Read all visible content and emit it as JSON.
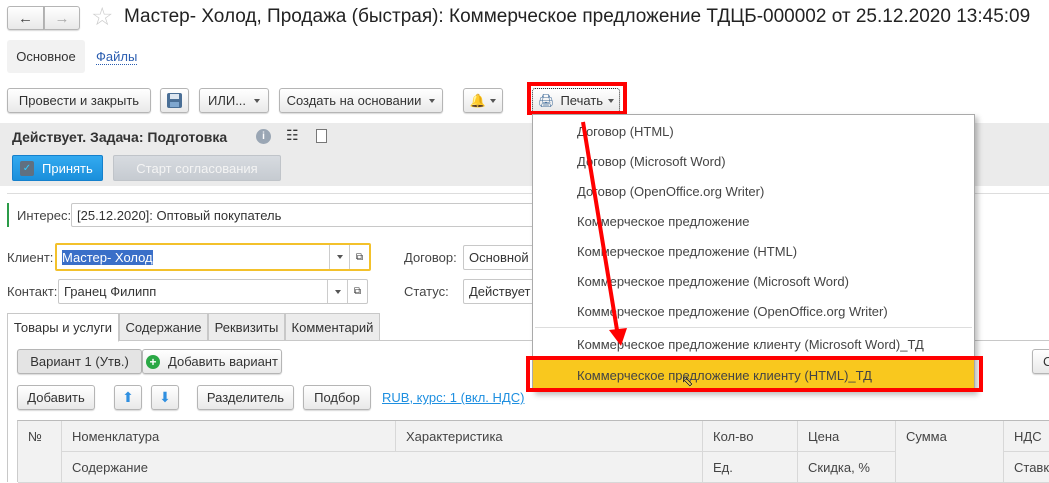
{
  "window": {
    "title": "Мастер- Холод, Продажа (быстрая): Коммерческое предложение ТДЦБ-000002 от 25.12.2020 13:45:09"
  },
  "nav_tabs": {
    "main": "Основное",
    "files": "Файлы"
  },
  "toolbar": {
    "post_close": "Провести и закрыть",
    "ili": "ИЛИ...",
    "create_based": "Создать на основании",
    "print": "Печать"
  },
  "status_panel": {
    "status": "Действует. Задача: Подготовка",
    "accept": "Принять",
    "start_approval": "Старт согласования"
  },
  "form": {
    "interest_label": "Интерес:",
    "interest_value": "[25.12.2020]: Оптовый покупатель",
    "client_label": "Клиент:",
    "client_value": "Мастер- Холод",
    "contract_label": "Договор:",
    "contract_value": "Основной д",
    "contact_label": "Контакт:",
    "contact_value": "Гранец Филипп",
    "status_label": "Статус:",
    "status_value": "Действует"
  },
  "tabs": [
    "Товары и услуги",
    "Содержание",
    "Реквизиты",
    "Комментарий"
  ],
  "goods": {
    "variant": "Вариант 1 (Утв.)",
    "add_variant": "Добавить вариант",
    "add": "Добавить",
    "separator": "Разделитель",
    "selection": "Подбор",
    "currency_link": "RUB, курс: 1 (вкл. НДС)",
    "right_button": "С"
  },
  "table": {
    "headers": {
      "num": "№",
      "nomenclature": "Номенклатура",
      "characteristic": "Характеристика",
      "qty": "Кол-во",
      "price": "Цена",
      "sum": "Сумма",
      "vat": "НДС",
      "content": "Содержание",
      "unit": "Ед.",
      "discount": "Скидка, %",
      "vat_rate": "Ставка"
    }
  },
  "print_menu": {
    "items": [
      "Договор (HTML)",
      "Договор (Microsoft Word)",
      "Договор (OpenOffice.org Writer)",
      "Коммерческое предложение",
      "Коммерческое предложение (HTML)",
      "Коммерческое предложение (Microsoft Word)",
      "Коммерческое предложение (OpenOffice.org Writer)"
    ],
    "custom_items": [
      "Коммерческое предложение клиенту (Microsoft Word)_ТД",
      "Коммерческое предложение клиенту (HTML)_ТД"
    ]
  },
  "colors": {
    "accent_blue": "#1e9be8",
    "highlight": "#f9c81e",
    "annotation_red": "#ff0000",
    "focus_yellow": "#f3c12b"
  }
}
